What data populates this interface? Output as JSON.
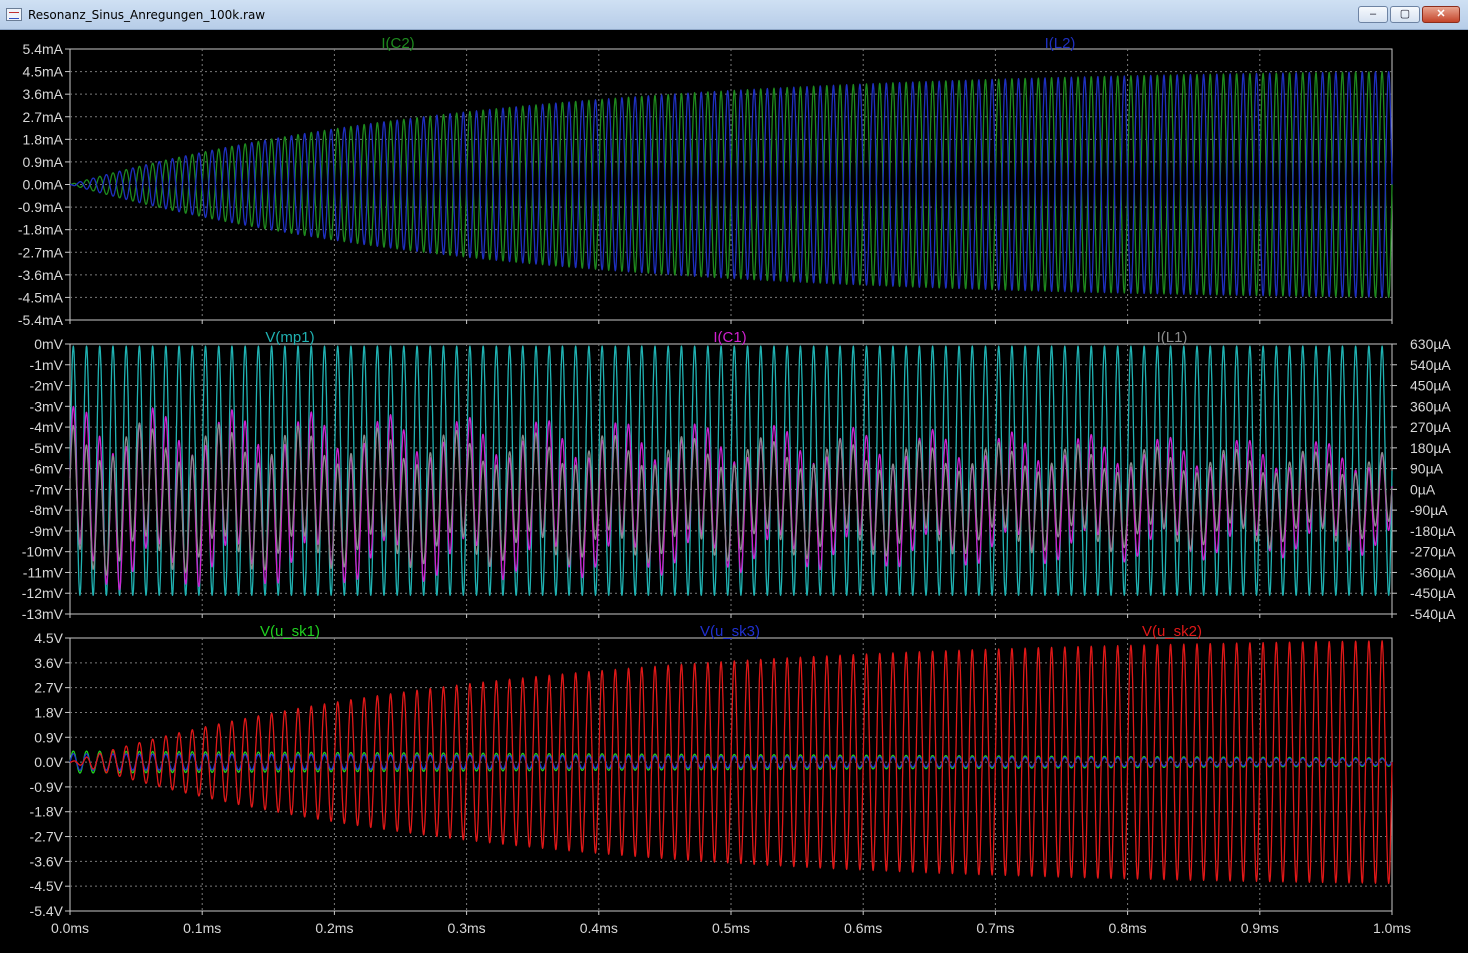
{
  "window": {
    "title": "Resonanz_Sinus_Anregungen_100k.raw",
    "minimize_glyph": "–",
    "maximize_glyph": "▢",
    "close_glyph": "✕"
  },
  "chart_data": [
    {
      "type": "line",
      "x_unit": "ms",
      "xlim": [
        0,
        1.0
      ],
      "x_ticks": [
        "0.0ms",
        "0.1ms",
        "0.2ms",
        "0.3ms",
        "0.4ms",
        "0.5ms",
        "0.6ms",
        "0.7ms",
        "0.8ms",
        "0.9ms",
        "1.0ms"
      ],
      "grid": true,
      "left_axis": {
        "unit": "mA",
        "ylim": [
          -5.4,
          5.4
        ],
        "ticks": [
          "5.4mA",
          "4.5mA",
          "3.6mA",
          "2.7mA",
          "1.8mA",
          "0.9mA",
          "0.0mA",
          "-0.9mA",
          "-1.8mA",
          "-2.7mA",
          "-3.6mA",
          "-4.5mA",
          "-5.4mA"
        ]
      },
      "series": [
        {
          "name": "I(C2)",
          "color": "#1e8a1e",
          "axis": "left",
          "frequency_khz": 100,
          "amplitude_start": 0,
          "amplitude_end": 4.5,
          "phase": 0
        },
        {
          "name": "I(L2)",
          "color": "#1e30c0",
          "axis": "left",
          "frequency_khz": 100,
          "amplitude_start": 0,
          "amplitude_end": 4.5,
          "phase": 3.14159
        }
      ]
    },
    {
      "type": "line",
      "x_unit": "ms",
      "xlim": [
        0,
        1.0
      ],
      "x_ticks": [
        "0.0ms",
        "0.1ms",
        "0.2ms",
        "0.3ms",
        "0.4ms",
        "0.5ms",
        "0.6ms",
        "0.7ms",
        "0.8ms",
        "0.9ms",
        "1.0ms"
      ],
      "grid": true,
      "left_axis": {
        "unit": "mV",
        "ylim": [
          -13,
          0
        ],
        "ticks": [
          "0mV",
          "-1mV",
          "-2mV",
          "-3mV",
          "-4mV",
          "-5mV",
          "-6mV",
          "-7mV",
          "-8mV",
          "-9mV",
          "-10mV",
          "-11mV",
          "-12mV",
          "-13mV"
        ]
      },
      "right_axis": {
        "unit": "µA",
        "ylim": [
          -540,
          630
        ],
        "ticks": [
          "630µA",
          "540µA",
          "450µA",
          "360µA",
          "270µA",
          "180µA",
          "90µA",
          "0µA",
          "-90µA",
          "-180µA",
          "-270µA",
          "-360µA",
          "-450µA",
          "-540µA"
        ]
      },
      "series": [
        {
          "name": "V(mp1)",
          "color": "#20b2b2",
          "axis": "left",
          "frequency_khz": 100,
          "offset": -6.1,
          "amplitude": 6.0
        },
        {
          "name": "I(C1)",
          "color": "#d020d0",
          "axis": "right",
          "frequency_khz": 100,
          "offset": -40,
          "amplitude_start": 300,
          "amplitude_end": 180
        },
        {
          "name": "I(L1)",
          "color": "#8a8a8a",
          "axis": "right",
          "frequency_khz": 100,
          "offset": -40,
          "amplitude_start": 250,
          "amplitude_end": 150
        }
      ]
    },
    {
      "type": "line",
      "x_unit": "ms",
      "xlim": [
        0,
        1.0
      ],
      "x_ticks": [
        "0.0ms",
        "0.1ms",
        "0.2ms",
        "0.3ms",
        "0.4ms",
        "0.5ms",
        "0.6ms",
        "0.7ms",
        "0.8ms",
        "0.9ms",
        "1.0ms"
      ],
      "grid": true,
      "left_axis": {
        "unit": "V",
        "ylim": [
          -5.4,
          4.5
        ],
        "ticks": [
          "4.5V",
          "3.6V",
          "2.7V",
          "1.8V",
          "0.9V",
          "0.0V",
          "-0.9V",
          "-1.8V",
          "-2.7V",
          "-3.6V",
          "-4.5V",
          "-5.4V"
        ]
      },
      "series": [
        {
          "name": "V(u_sk1)",
          "color": "#20d020",
          "axis": "left",
          "frequency_khz": 100,
          "amplitude_start": 0.4,
          "amplitude_end": 0.15
        },
        {
          "name": "V(u_sk3)",
          "color": "#2030d0",
          "axis": "left",
          "frequency_khz": 100,
          "amplitude_start": 0.3,
          "amplitude_end": 0.12
        },
        {
          "name": "V(u_sk2)",
          "color": "#e01818",
          "axis": "left",
          "frequency_khz": 100,
          "amplitude_start": 0,
          "amplitude_end": 4.4
        }
      ]
    }
  ]
}
